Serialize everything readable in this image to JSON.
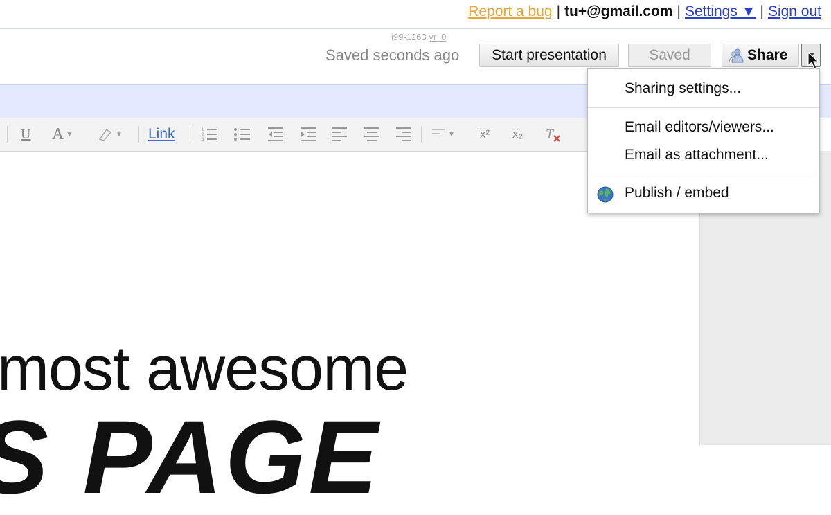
{
  "account_bar": {
    "report_bug": "Report a bug",
    "email": "tu+@gmail.com",
    "settings": "Settings ▼",
    "sign_out": "Sign out",
    "separator": "|"
  },
  "header": {
    "doc_id_prefix": "i99-1263",
    "doc_id_suffix": "yr_0",
    "saved_status": "Saved seconds ago",
    "start_presentation": "Start presentation",
    "saved_button": "Saved",
    "share_button": "Share"
  },
  "toolbar": {
    "underline": "U",
    "text_color": "A",
    "link": "Link",
    "superscript": "x²",
    "subscript": "x₂"
  },
  "share_menu": {
    "items": [
      "Sharing settings...",
      "Email editors/viewers...",
      "Email as attachment...",
      "Publish / embed"
    ]
  },
  "document": {
    "line1": "most awesome",
    "line2": "S PAGE"
  },
  "colors": {
    "link_blue": "#2a3ec8",
    "report_bug_orange": "#e6a23c",
    "band_blue": "#e3e9ff"
  }
}
